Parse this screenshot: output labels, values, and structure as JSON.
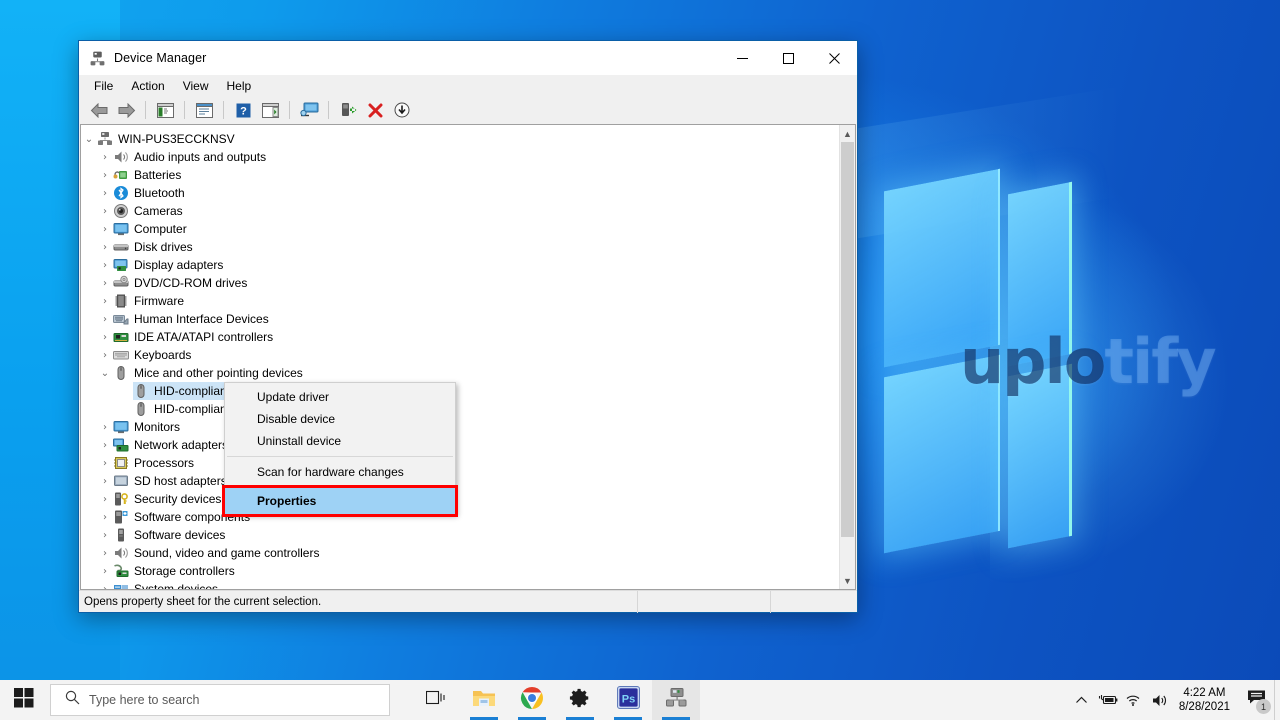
{
  "desktop": {
    "watermark_bright": "uplo",
    "watermark_dim": "tify"
  },
  "window": {
    "title": "Device Manager",
    "icon": "device-manager-icon",
    "controls": {
      "minimize": "─",
      "maximize": "☐",
      "close": "✕"
    },
    "menus": [
      "File",
      "Action",
      "View",
      "Help"
    ],
    "toolbar": [
      {
        "name": "back-button",
        "icon": "back-arrow-icon"
      },
      {
        "name": "forward-button",
        "icon": "forward-arrow-icon"
      },
      {
        "name": "separator-1",
        "icon": "separator"
      },
      {
        "name": "show-hide-console-tree-button",
        "icon": "console-tree-icon"
      },
      {
        "name": "separator-2",
        "icon": "separator"
      },
      {
        "name": "properties-button",
        "icon": "properties-window-icon"
      },
      {
        "name": "separator-3",
        "icon": "separator"
      },
      {
        "name": "help-button",
        "icon": "help-question-icon"
      },
      {
        "name": "show-actions-pane-button",
        "icon": "actions-pane-icon"
      },
      {
        "name": "separator-4",
        "icon": "separator"
      },
      {
        "name": "scan-hardware-changes-button",
        "icon": "monitor-scan-icon"
      },
      {
        "name": "separator-5",
        "icon": "separator"
      },
      {
        "name": "update-driver-button",
        "icon": "update-driver-icon"
      },
      {
        "name": "uninstall-device-button",
        "icon": "red-x-icon"
      },
      {
        "name": "disable-device-button",
        "icon": "disable-down-arrow-icon"
      }
    ],
    "statusbar": {
      "message": "Opens property sheet for the current selection.",
      "cell2": "",
      "cell3": ""
    }
  },
  "tree": {
    "root": {
      "label": "WIN-PUS3ECCKNSV",
      "icon": "computer-node-icon",
      "twisty": "expanded"
    },
    "nodes": [
      {
        "label": "Audio inputs and outputs",
        "icon": "speaker-icon",
        "twisty": "collapsed",
        "depth": 1
      },
      {
        "label": "Batteries",
        "icon": "battery-icon",
        "twisty": "collapsed",
        "depth": 1
      },
      {
        "label": "Bluetooth",
        "icon": "bluetooth-icon",
        "twisty": "collapsed",
        "depth": 1
      },
      {
        "label": "Cameras",
        "icon": "camera-icon",
        "twisty": "collapsed",
        "depth": 1
      },
      {
        "label": "Computer",
        "icon": "monitor-icon",
        "twisty": "collapsed",
        "depth": 1
      },
      {
        "label": "Disk drives",
        "icon": "disk-drive-icon",
        "twisty": "collapsed",
        "depth": 1
      },
      {
        "label": "Display adapters",
        "icon": "display-adapter-icon",
        "twisty": "collapsed",
        "depth": 1
      },
      {
        "label": "DVD/CD-ROM drives",
        "icon": "dvd-drive-icon",
        "twisty": "collapsed",
        "depth": 1
      },
      {
        "label": "Firmware",
        "icon": "firmware-chip-icon",
        "twisty": "collapsed",
        "depth": 1
      },
      {
        "label": "Human Interface Devices",
        "icon": "hid-icon",
        "twisty": "collapsed",
        "depth": 1
      },
      {
        "label": "IDE ATA/ATAPI controllers",
        "icon": "ide-controller-icon",
        "twisty": "collapsed",
        "depth": 1
      },
      {
        "label": "Keyboards",
        "icon": "keyboard-icon",
        "twisty": "collapsed",
        "depth": 1
      },
      {
        "label": "Mice and other pointing devices",
        "icon": "mouse-icon",
        "twisty": "expanded",
        "depth": 1
      },
      {
        "label": "HID-compliant mouse",
        "icon": "mouse-icon",
        "twisty": "none",
        "depth": 2,
        "selected": true
      },
      {
        "label": "HID-compliant mouse",
        "icon": "mouse-icon",
        "twisty": "none",
        "depth": 2
      },
      {
        "label": "Monitors",
        "icon": "monitor-icon",
        "twisty": "collapsed",
        "depth": 1
      },
      {
        "label": "Network adapters",
        "icon": "network-adapter-icon",
        "twisty": "collapsed",
        "depth": 1
      },
      {
        "label": "Processors",
        "icon": "processor-icon",
        "twisty": "collapsed",
        "depth": 1
      },
      {
        "label": "SD host adapters",
        "icon": "sd-host-icon",
        "twisty": "collapsed",
        "depth": 1
      },
      {
        "label": "Security devices",
        "icon": "security-device-icon",
        "twisty": "collapsed",
        "depth": 1
      },
      {
        "label": "Software components",
        "icon": "software-component-icon",
        "twisty": "collapsed",
        "depth": 1
      },
      {
        "label": "Software devices",
        "icon": "software-device-icon",
        "twisty": "collapsed",
        "depth": 1
      },
      {
        "label": "Sound, video and game controllers",
        "icon": "speaker-icon",
        "twisty": "collapsed",
        "depth": 1
      },
      {
        "label": "Storage controllers",
        "icon": "storage-controller-icon",
        "twisty": "collapsed",
        "depth": 1
      },
      {
        "label": "System devices",
        "icon": "system-device-icon",
        "twisty": "collapsed",
        "depth": 1
      }
    ]
  },
  "context_menu": {
    "items": [
      {
        "label": "Update driver"
      },
      {
        "label": "Disable device"
      },
      {
        "label": "Uninstall device"
      },
      {
        "separator": true
      },
      {
        "label": "Scan for hardware changes"
      }
    ],
    "highlighted": {
      "label": "Properties",
      "highlight_color": "#9ed2f5",
      "outline_color": "#ff0000"
    }
  },
  "taskbar": {
    "start": "start-icon",
    "search": {
      "placeholder": "Type here to search",
      "icon": "search-icon"
    },
    "apps": [
      {
        "name": "task-view-button",
        "icon": "task-view-icon",
        "active": false,
        "running": false
      },
      {
        "name": "file-explorer-button",
        "icon": "file-explorer-icon",
        "active": false,
        "running": true
      },
      {
        "name": "chrome-button",
        "icon": "chrome-icon",
        "active": false,
        "running": true
      },
      {
        "name": "settings-button",
        "icon": "gear-icon",
        "active": false,
        "running": true
      },
      {
        "name": "photoshop-button",
        "icon": "photoshop-icon",
        "label": "Ps",
        "active": false,
        "running": true
      },
      {
        "name": "device-manager-button",
        "icon": "device-manager-icon",
        "active": true,
        "running": true
      }
    ],
    "tray": [
      {
        "name": "show-hidden-icons-button",
        "icon": "chevron-up-icon"
      },
      {
        "name": "battery-button",
        "icon": "battery-charging-icon"
      },
      {
        "name": "network-button",
        "icon": "wifi-icon"
      },
      {
        "name": "volume-button",
        "icon": "speaker-icon"
      }
    ],
    "clock": {
      "time": "4:22 AM",
      "date": "8/28/2021"
    },
    "notifications": {
      "icon": "notification-icon",
      "count": "1"
    }
  },
  "colors": {
    "accent": "#0a5fa8",
    "selection": "#cce4f7",
    "menu_highlight": "#9ed2f5",
    "outline_red": "#ff0000",
    "taskbar": "#f3f3f3"
  }
}
